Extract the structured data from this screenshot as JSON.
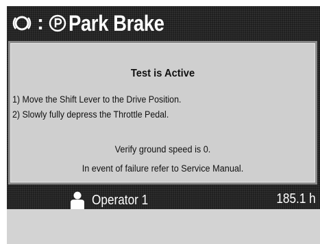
{
  "header": {
    "separator": ":",
    "title": "Park Brake",
    "brake_icon": "brake-warning-icon",
    "p_icon": "parking-p-icon"
  },
  "panel": {
    "title": "Test is Active",
    "instructions": [
      "1) Move the Shift Lever to the Drive Position.",
      "2) Slowly fully depress the Throttle Pedal."
    ],
    "verify": "Verify ground speed is 0.",
    "failure": "In event of failure refer to Service Manual."
  },
  "footer": {
    "operator_icon": "operator-icon",
    "operator_label": "Operator 1",
    "hours": "185.1 h"
  },
  "colors": {
    "screen_bg": "#1f1f1f",
    "panel_bg": "#cfcfcf",
    "panel_border": "#8a8a8a",
    "bottom_strip": "#d3d3d3"
  }
}
